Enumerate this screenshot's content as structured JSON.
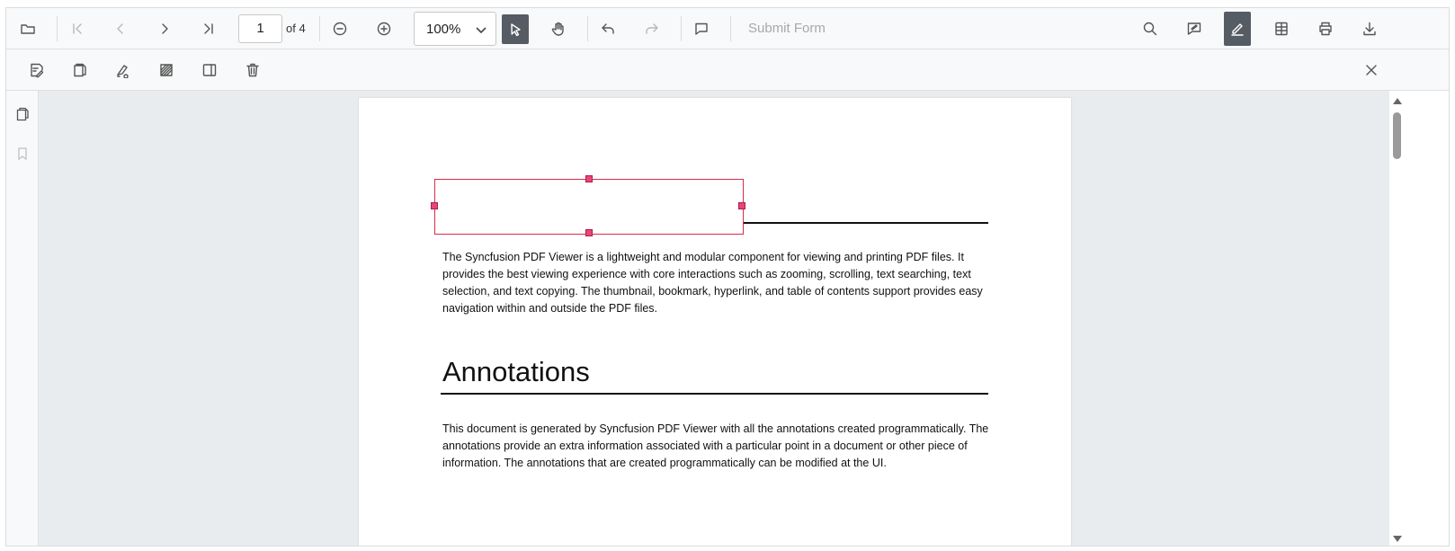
{
  "toolbar": {
    "current_page": "1",
    "page_count_label": "of 4",
    "zoom_value": "100%",
    "submit_form_label": "Submit Form"
  },
  "document": {
    "paragraph1": "The Syncfusion PDF Viewer is a lightweight and modular component for viewing and printing PDF files. It provides the best viewing experience with core interactions such as zooming, scrolling, text searching, text selection, and text copying. The thumbnail, bookmark, hyperlink, and table of contents support provides easy navigation within and outside the PDF files.",
    "heading": "Annotations",
    "paragraph2": "This document is generated by Syncfusion PDF Viewer with all the annotations created programmatically. The annotations provide an extra information associated with a particular point in a document or other piece of information. The annotations that are created programmatically can be modified at the UI."
  },
  "colors": {
    "active_tool": "#555c63",
    "selection_border": "#d92c4a",
    "selection_handle": "#e8457a",
    "canvas_background": "#e9ecef"
  }
}
